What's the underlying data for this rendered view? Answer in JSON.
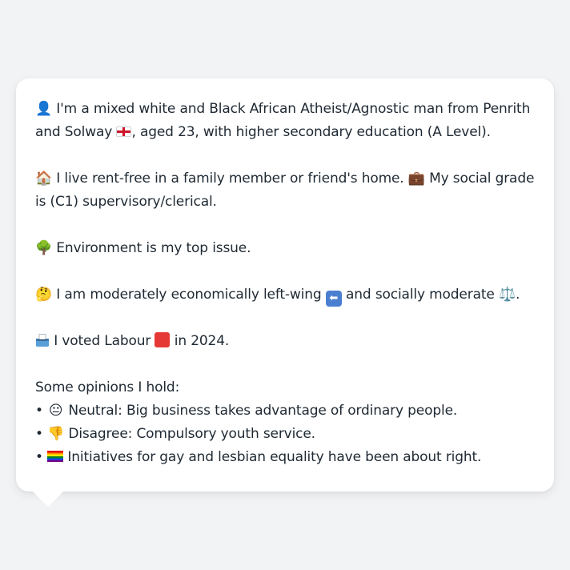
{
  "profile": {
    "line1_before_flag": "I'm a mixed white and Black African Atheist/Agnostic man from Penrith and Solway",
    "line1_after_flag": ", aged 23, with higher secondary education (A Level).",
    "housing": "I live rent-free in a family member or friend's home.",
    "social_grade": "My social grade is (C1) supervisory/clerical.",
    "top_issue": "Environment is my top issue.",
    "econ_before": "I am moderately economically left-wing",
    "econ_middle": "and socially moderate",
    "econ_end": ".",
    "vote_before": "I voted Labour",
    "vote_after": "in 2024.",
    "opinions_heading": "Some opinions I hold:",
    "bullet": "•",
    "opinions": [
      {
        "emoji": "😐",
        "text": "Neutral: Big business takes advantage of ordinary people."
      },
      {
        "emoji": "👎",
        "text": "Disagree: Compulsory youth service."
      },
      {
        "emoji": "rainbow-flag",
        "text": "Initiatives for gay and lesbian equality have been about right."
      }
    ]
  },
  "icons": {
    "person": "👤",
    "house": "🏠",
    "briefcase": "💼",
    "tree": "🌳",
    "thinking": "🤔",
    "scales": "⚖️",
    "arrow_left": "⬅",
    "england_flag": "england-flag-icon",
    "ballot_box": "ballot-box-icon"
  },
  "colors": {
    "page_background": "#f2f3f5",
    "card_background": "#ffffff",
    "text": "#1f2933",
    "labour_red": "#e53935"
  }
}
